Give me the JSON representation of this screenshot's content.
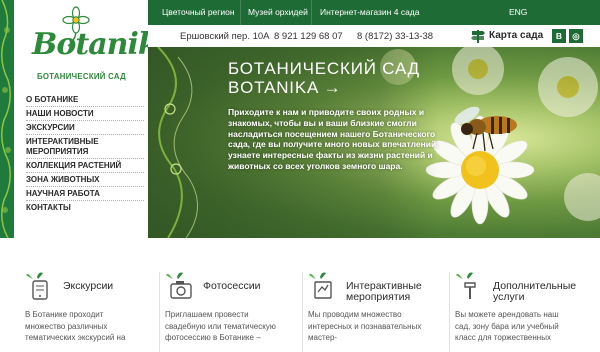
{
  "topnav": {
    "items": [
      {
        "label": "Цветочный регион"
      },
      {
        "label": "Музей орхидей"
      },
      {
        "label": "Интернет-магазин 4 сада"
      },
      {
        "label": "ENG"
      }
    ]
  },
  "brand": {
    "logo_text": "Botanika",
    "subtitle": "БОТАНИЧЕСКИЙ САД"
  },
  "sidebar": {
    "items": [
      {
        "label": "О Ботанике"
      },
      {
        "label": "Наши новости"
      },
      {
        "label": "Экскурсии"
      },
      {
        "label": "Интерактивные\nмероприятия"
      },
      {
        "label": "Коллекция растений"
      },
      {
        "label": "Зона животных"
      },
      {
        "label": "Научная работа"
      },
      {
        "label": "Контакты"
      }
    ]
  },
  "contact": {
    "address": "Ершовский пер. 10А",
    "phone1": "8 921 129 68 07",
    "phone2": "8 (8172) 33-13-38",
    "map_label": "Карта сада",
    "social": [
      "В",
      "◎"
    ]
  },
  "hero": {
    "title": "Ботанический сад\nBotanika →",
    "text": "Приходите к нам и приводите своих родных и знакомых, чтобы вы и ваши близкие смогли насладиться посещением нашего Ботанического сада, где вы получите много новых впечатлений, узнаете интересные факты из жизни растений и животных со всех уголков земного шара."
  },
  "features": [
    {
      "title": "Экскурсии",
      "text": "В Ботанике проходит множество различных тематических экскурсий на",
      "icon": "tablet-icon"
    },
    {
      "title": "Фотосессии",
      "text": "Приглашаем провести свадебную или тематическую фотосессию в Ботанике –",
      "icon": "camera-icon"
    },
    {
      "title": "Интерактивные\nмероприятия",
      "text": "Мы проводим множество интересных и познавательных мастер-",
      "icon": "activity-icon"
    },
    {
      "title": "Дополнительные\nуслуги",
      "text": "Вы можете арендовать наш сад, зону бара или учебный класс для торжественных",
      "icon": "hammer-icon"
    }
  ],
  "colors": {
    "brand_green": "#1e6b35",
    "logo_green": "#2d8a3b",
    "accent_light": "#8ec641"
  }
}
